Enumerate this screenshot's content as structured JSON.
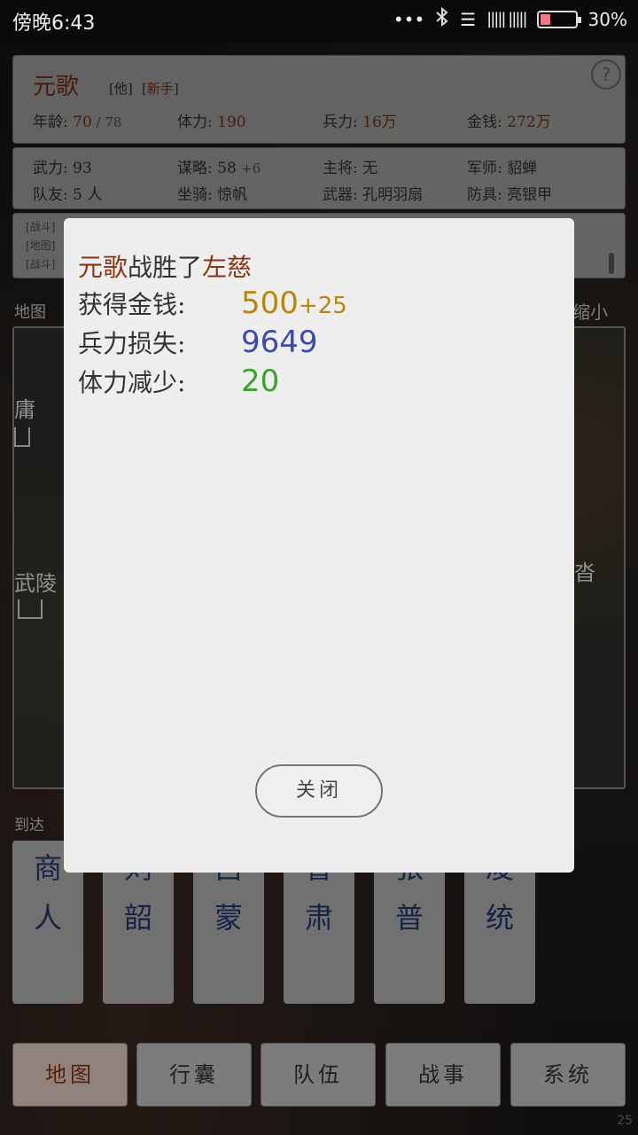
{
  "status_bar": {
    "time": "傍晚6:43",
    "signal_dots": "•••",
    "bluetooth_icon": "bluetooth-icon",
    "signal_bars": "|||||  |||||",
    "battery_percent": "30%",
    "battery_level": 0.3
  },
  "character": {
    "name": "元歌",
    "tag1": "他",
    "tag2": "新手",
    "age_label": "年龄:",
    "age": "70",
    "age_max": "78",
    "stamina_label": "体力:",
    "stamina": "190",
    "troops_label": "兵力:",
    "troops": "16万",
    "money_label": "金钱:",
    "money": "272万",
    "help": "?"
  },
  "attributes": {
    "force_label": "武力:",
    "force": "93",
    "strategy_label": "谋略:",
    "strategy": "58",
    "strategy_bonus": "+6",
    "general_label": "主将:",
    "general": "无",
    "advisor_label": "军师:",
    "advisor": "貂蝉",
    "teammates_label": "队友:",
    "teammates": "5 人",
    "mount_label": "坐骑:",
    "mount": "惊帆",
    "weapon_label": "武器:",
    "weapon": "孔明羽扇",
    "armor_label": "防具:",
    "armor": "亮银甲"
  },
  "log": [
    "[战斗]",
    "[地图]",
    "[战斗]"
  ],
  "map": {
    "label": "地图",
    "shrink": "缩小",
    "cities": [
      "庸",
      "武陵",
      "沓"
    ]
  },
  "arrive": {
    "label": "到达"
  },
  "people": [
    {
      "c1": "商",
      "c2": "人"
    },
    {
      "c1": "刘",
      "c2": "韶"
    },
    {
      "c1": "吕",
      "c2": "蒙"
    },
    {
      "c1": "鲁",
      "c2": "肃"
    },
    {
      "c1": "张",
      "c2": "普"
    },
    {
      "c1": "凌",
      "c2": "统"
    }
  ],
  "nav": [
    "地图",
    "行囊",
    "队伍",
    "战事",
    "系统"
  ],
  "page_number": "25",
  "dialog": {
    "winner": "元歌",
    "verb": "战胜了",
    "loser": "左慈",
    "money_label": "获得金钱:",
    "money_value": "500",
    "money_bonus": "+25",
    "loss_label": "兵力损失:",
    "loss_value": "9649",
    "stamina_label": "体力减少:",
    "stamina_value": "20",
    "close_label": "关闭"
  }
}
